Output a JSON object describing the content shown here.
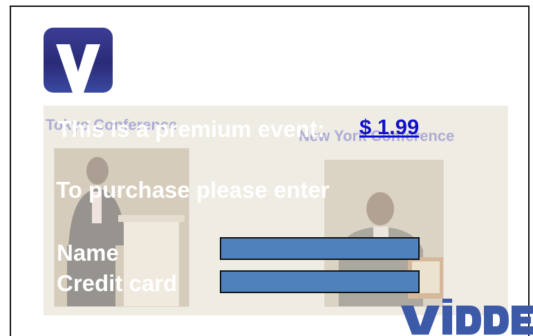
{
  "app": {
    "logo_icon": "vidder-v-logo-icon",
    "brand_icon": "vidder-wordmark-icon",
    "brand_text": "vidder"
  },
  "video": {
    "left_conference": "Tokyo Conference",
    "right_conference": "New York Conference"
  },
  "paywall": {
    "premium_text": "This is a premium event:",
    "price": "$ 1.99",
    "purchase_prompt": "To purchase please enter",
    "name_label": "Name",
    "credit_card_label": "Credit card",
    "name_value": "",
    "credit_card_value": ""
  },
  "colors": {
    "field_fill": "#4f81bd",
    "logo_blue": "#2a2b78",
    "link_blue": "#1010c8",
    "panel_bg": "#efece4"
  }
}
